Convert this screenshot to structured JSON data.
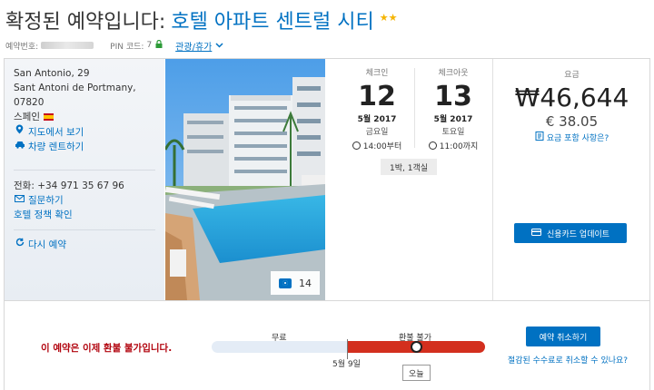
{
  "header": {
    "title": "확정된 예약입니다:",
    "hotel_name": "호텔 아파트 센트럴 시티",
    "stars": "★★"
  },
  "refbar": {
    "booking_label": "예약번호:",
    "pin_label": "PIN 코드:",
    "pin_value": "7",
    "link": "관광/휴가"
  },
  "address": {
    "line1": "San Antonio, 29",
    "line2": "Sant Antoni de Portmany,",
    "line3": "07820",
    "country": "스페인"
  },
  "links": {
    "map": "지도에서 보기",
    "car": "차량 렌트하기",
    "ask": "질문하기",
    "policy": "호텔 정책 확인",
    "rebook": "다시 예약"
  },
  "phone": "전화: +34 971 35 67 96",
  "photo": {
    "count": "14"
  },
  "checkin": {
    "label": "체크인",
    "day": "12",
    "month": "5월 2017",
    "weekday": "금요일",
    "time": "14:00부터"
  },
  "checkout": {
    "label": "체크아웃",
    "day": "13",
    "month": "5월 2017",
    "weekday": "토요일",
    "time": "11:00까지"
  },
  "stay_summary": "1박, 1객실",
  "price": {
    "label": "요금",
    "krw": "₩46,644",
    "eur": "€ 38.05",
    "includes_link": "요금 포함 사항은?",
    "update_card_button": "신용카드 업데이트"
  },
  "cancellation": {
    "message": "이 예약은 이제 환불 불가입니다.",
    "free_label": "무료",
    "nonrefundable_label": "환불 불가",
    "deadline": "5월 9일",
    "today": "오늘",
    "cancel_button": "예약 취소하기",
    "fee_link": "절감된 수수료로 취소할 수 있나요?"
  },
  "colors": {
    "brand_blue": "#0071c2",
    "nonrefundable_red": "#d32f1e",
    "star_gold": "#f5b400"
  }
}
